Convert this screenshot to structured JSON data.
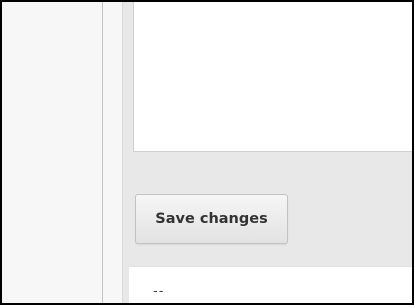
{
  "form": {
    "save_button_label": "Save changes"
  },
  "footer": {
    "text": "--"
  }
}
